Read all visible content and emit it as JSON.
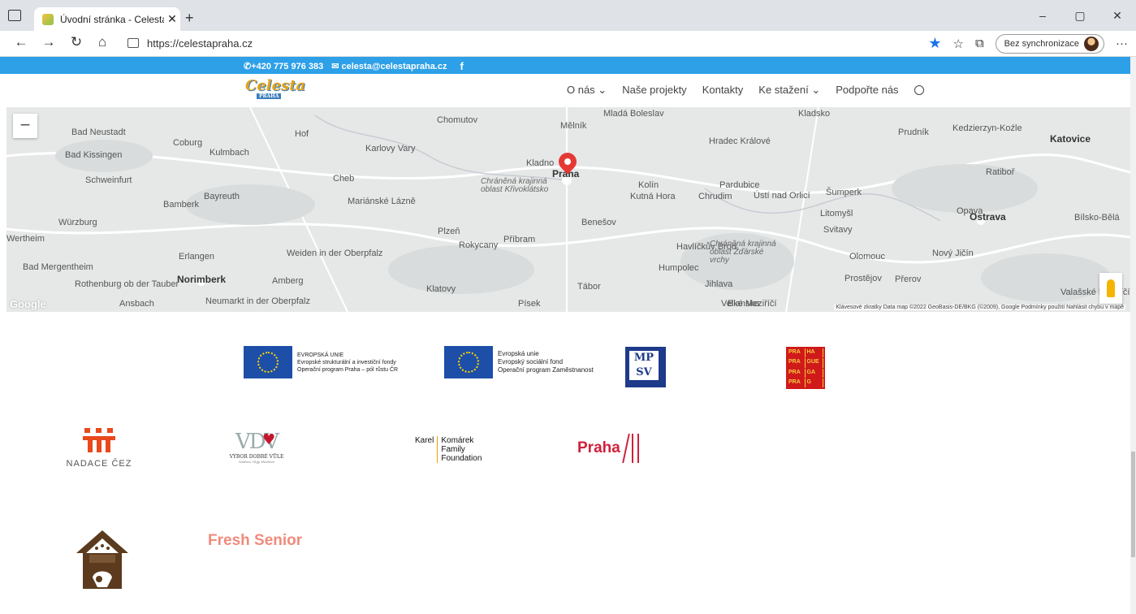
{
  "browser": {
    "tab_title": "Úvodní stránka - Celesta Praha, z",
    "tab_close": "✕",
    "new_tab": "+",
    "url": "https://celestapraha.cz",
    "sync_label": "Bez synchronizace",
    "window_minimize": "–",
    "window_maximize": "▢",
    "window_close": "✕",
    "back": "←",
    "forward": "→",
    "refresh": "↻",
    "home": "⌂",
    "favorites_icon": "☆",
    "collections_icon": "⧉",
    "more": "···"
  },
  "site": {
    "phone": "+420 775 976 383",
    "email": "celesta@celestapraha.cz",
    "facebook": "f",
    "logo_text": "Celesta",
    "logo_sub": "PRAHA",
    "menu": [
      "O nás ⌄",
      "Naše projekty",
      "Kontakty",
      "Ke stažení ⌄",
      "Podpořte nás"
    ]
  },
  "map": {
    "zoom_out": "−",
    "google": "Google",
    "attribution": "Klávesové zkratky   Data map ©2022 GeoBasis-DE/BKG (©2009), Google   Podmínky použití   Nahlásit chybu v mapě",
    "labels": [
      {
        "t": "Bad Neustadt",
        "cls": ""
      },
      {
        "t": "Coburg",
        "cls": ""
      },
      {
        "t": "Hof",
        "cls": ""
      },
      {
        "t": "Chomutov",
        "cls": ""
      },
      {
        "t": "Mělník",
        "cls": ""
      },
      {
        "t": "Mladá Boleslav",
        "cls": ""
      },
      {
        "t": "Hradec Králové",
        "cls": ""
      },
      {
        "t": "Kladsko",
        "cls": ""
      },
      {
        "t": "Prudník",
        "cls": ""
      },
      {
        "t": "Kedzierzyn-Koźle",
        "cls": ""
      },
      {
        "t": "Katovice",
        "cls": "big"
      },
      {
        "t": "Bad Kissingen",
        "cls": ""
      },
      {
        "t": "Kulmbach",
        "cls": ""
      },
      {
        "t": "Karlovy Vary",
        "cls": ""
      },
      {
        "t": "Kladno",
        "cls": ""
      },
      {
        "t": "Praha",
        "cls": "big"
      },
      {
        "t": "Kolín",
        "cls": ""
      },
      {
        "t": "Pardubice",
        "cls": ""
      },
      {
        "t": "Ratiboř",
        "cls": ""
      },
      {
        "t": "Schweinfurt",
        "cls": ""
      },
      {
        "t": "Cheb",
        "cls": ""
      },
      {
        "t": "Chráněná krajinná oblast Křivoklátsko",
        "cls": "em"
      },
      {
        "t": "Kutná Hora",
        "cls": ""
      },
      {
        "t": "Chrudim",
        "cls": ""
      },
      {
        "t": "Ústí nad Orlicí",
        "cls": ""
      },
      {
        "t": "Šumperk",
        "cls": ""
      },
      {
        "t": "Ostrava",
        "cls": "big"
      },
      {
        "t": "Bamberk",
        "cls": ""
      },
      {
        "t": "Bayreuth",
        "cls": ""
      },
      {
        "t": "Mariánské Lázně",
        "cls": ""
      },
      {
        "t": "Würzburg",
        "cls": ""
      },
      {
        "t": "Plzeň",
        "cls": ""
      },
      {
        "t": "Benešov",
        "cls": ""
      },
      {
        "t": "Opava",
        "cls": ""
      },
      {
        "t": "Bílsko-Bělá",
        "cls": ""
      },
      {
        "t": "Wertheim",
        "cls": ""
      },
      {
        "t": "Erlangen",
        "cls": ""
      },
      {
        "t": "Weiden in der Oberpfalz",
        "cls": ""
      },
      {
        "t": "Rokycany",
        "cls": ""
      },
      {
        "t": "Příbram",
        "cls": ""
      },
      {
        "t": "Havlíčkův Brod",
        "cls": ""
      },
      {
        "t": "Chráněná krajinná oblast Žďárské vrchy",
        "cls": "em"
      },
      {
        "t": "Olomouc",
        "cls": ""
      },
      {
        "t": "Nový Jičín",
        "cls": ""
      },
      {
        "t": "Bad Mergentheim",
        "cls": ""
      },
      {
        "t": "Norimberk",
        "cls": "big"
      },
      {
        "t": "Amberg",
        "cls": ""
      },
      {
        "t": "Klatovy",
        "cls": ""
      },
      {
        "t": "Tábor",
        "cls": ""
      },
      {
        "t": "Jihlava",
        "cls": ""
      },
      {
        "t": "Prostějov",
        "cls": ""
      },
      {
        "t": "Přerov",
        "cls": ""
      },
      {
        "t": "Rothenburg ob der Tauber",
        "cls": ""
      },
      {
        "t": "Ansbach",
        "cls": ""
      },
      {
        "t": "Neumarkt in der Oberpfalz",
        "cls": ""
      },
      {
        "t": "Písek",
        "cls": ""
      },
      {
        "t": "Blansko",
        "cls": ""
      },
      {
        "t": "Valašské Meziříčí",
        "cls": ""
      },
      {
        "t": "Velké Meziříčí",
        "cls": ""
      },
      {
        "t": "Humpolec",
        "cls": ""
      },
      {
        "t": "Svitavy",
        "cls": ""
      },
      {
        "t": "Litomyšl",
        "cls": ""
      }
    ]
  },
  "partners": {
    "eu1": [
      "EVROPSKÁ UNIE",
      "Evropské strukturální a investiční fondy",
      "Operační program Praha – pól růstu ČR"
    ],
    "eu2": [
      "Evropská unie",
      "Evropský sociální fond",
      "Operační program Zaměstnanost"
    ],
    "mpsv": "MP SV",
    "praha_grid": [
      "PRA",
      "HA",
      "PRA",
      "GUE",
      "PRA",
      "GA",
      "PRA",
      "G"
    ],
    "cez": "NADACE ČEZ",
    "vdv_letters": "VDV",
    "vdv_caption": "VÝBOR DOBRÉ VŮLE",
    "vdv_sub": "Nadace Olgy Havlové",
    "komarek_first": "Karel",
    "komarek_rest": [
      "Komárek",
      "Family",
      "Foundation"
    ],
    "praha": "Praha",
    "fresh_senior": "Fresh Senior"
  }
}
